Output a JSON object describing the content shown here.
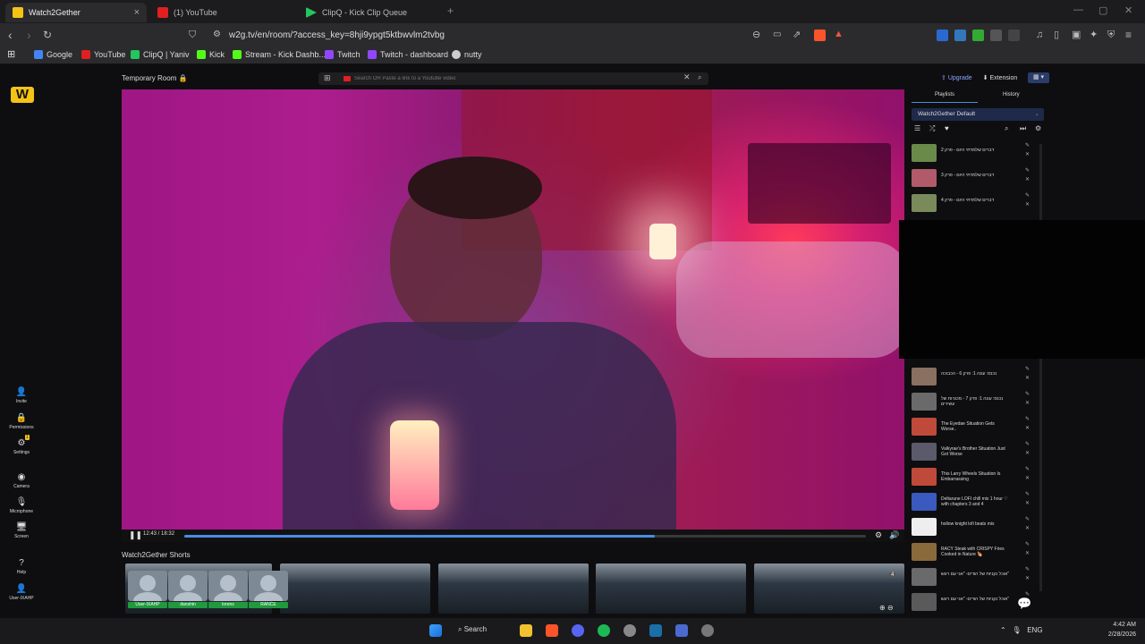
{
  "tabs": [
    {
      "title": "Watch2Gether",
      "active": true,
      "close": "×"
    },
    {
      "title": "(1) YouTube",
      "active": false
    },
    {
      "title": "ClipQ - Kick Clip Queue",
      "active": false
    },
    {
      "new_tab": "+"
    }
  ],
  "window_controls": {
    "minimize": "—",
    "maximize": "▢",
    "close": "✕"
  },
  "navbar": {
    "url": "w2g.tv/en/room/?access_key=8hji9ypgt5ktbwvlm2tvbg"
  },
  "bookmarks": [
    {
      "label": "Google",
      "color": "#4285f4"
    },
    {
      "label": "YouTube",
      "color": "#e02020"
    },
    {
      "label": "ClipQ | Yaniv",
      "color": "#22c55e"
    },
    {
      "label": "Kick",
      "color": "#53fc18"
    },
    {
      "label": "Stream - Kick Dashb...",
      "color": "#53fc18"
    },
    {
      "label": "Twitch",
      "color": "#9146ff"
    },
    {
      "label": "Twitch - dashboard",
      "color": "#9146ff"
    },
    {
      "label": "nutty",
      "color": "#cccccc"
    }
  ],
  "rail": {
    "logo": "W",
    "invite": "Invite",
    "permissions": "Permissions",
    "settings": "Settings",
    "settings_badge": "1",
    "camera": "Camera",
    "microphone": "Microphone",
    "screen": "Screen",
    "help": "Help",
    "user": "User-IXAHP"
  },
  "room": {
    "title": "Temporary Room 🔒",
    "search_placeholder": "Search OR Paste a link to a Youtube video"
  },
  "player": {
    "time": "12:43 / 18:32",
    "progress": 0.69
  },
  "shorts": {
    "label": "Watch2Gether Shorts",
    "badge": "4"
  },
  "users": [
    {
      "name": "User-IXAHP"
    },
    {
      "name": "danshin"
    },
    {
      "name": "lorens"
    },
    {
      "name": "RANCE"
    }
  ],
  "right": {
    "upgrade": "Upgrade",
    "extension": "Extension",
    "tabs": [
      "Playlists",
      "History"
    ],
    "playlist_name": "Watch2Gether Default",
    "items": [
      {
        "title": "דברים שלמדתי היום - פרק 2",
        "color": "#6a8a4a"
      },
      {
        "title": "דברים שלמדתי היום - פרק 3",
        "color": "#b05a6a"
      },
      {
        "title": "דברים שלמדתי היום - פרק 4",
        "color": "#7a8a5a"
      },
      {
        "title": "נכנס: עונה 1: פרק 6 - הכבוכה",
        "color": "#8a7060"
      },
      {
        "title": "נכנס: עונה 1: פרק 7 - מכוניות של עשירים",
        "color": "#6a6a6a"
      },
      {
        "title": "The Eyedae Situation Gets Worse..",
        "color": "#c04a3a"
      },
      {
        "title": "Valkyrae's Brother Situation Just Got Worse",
        "color": "#5a5a6a"
      },
      {
        "title": "This Larry Wheels Situation Is Embarrassing",
        "color": "#c04a3a"
      },
      {
        "title": "Deltarune LOFI chill mix 1 hour ♡ with chapters 3 and 4",
        "color": "#3a5ac0"
      },
      {
        "title": "hollow knight lofi beats mix",
        "color": "#eeeeee"
      },
      {
        "title": "RACY Steak with CRISPY Fries Cooked in Nature 🍖",
        "color": "#8a6a3a"
      },
      {
        "title": "אוכל נקניות של הודים- \"אני עם רעש\"",
        "color": "#6a6a6a"
      },
      {
        "title": "אוכל נקניות של הודים- \"אני עם רעש\"",
        "color": "#5a5a5a"
      }
    ]
  },
  "taskbar": {
    "search": "Search",
    "lang": "ENG",
    "time": "4:42 AM",
    "date": "2/28/2026"
  },
  "colors": {
    "accent": "#4a8de6",
    "brand": "#f3c316",
    "user_tag": "#1f9a3d"
  }
}
